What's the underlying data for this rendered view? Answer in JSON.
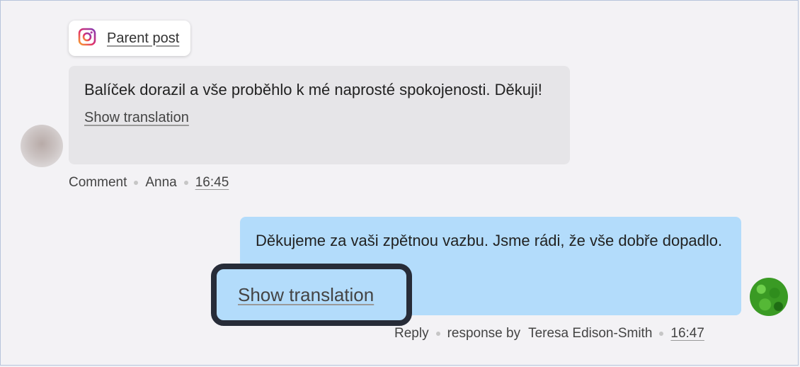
{
  "parent_post": {
    "icon": "instagram-icon",
    "label": "Parent post"
  },
  "incoming": {
    "message": "Balíček dorazil a vše proběhlo k mé naprosté spokojenosti. Děkuji!",
    "show_translation": "Show translation",
    "meta": {
      "type": "Comment",
      "author": "Anna",
      "time": "16:45"
    }
  },
  "outgoing": {
    "message": "Děkujeme za vaši zpětnou vazbu. Jsme rádi, že vše dobře dopadlo.",
    "show_translation": "Show translation",
    "meta": {
      "type": "Reply",
      "by_label": "response by",
      "author": "Teresa Edison-Smith",
      "time": "16:47"
    }
  },
  "colors": {
    "incoming_bubble": "#e6e5e8",
    "outgoing_bubble": "#b3dcfb",
    "highlight_border": "#272c38"
  }
}
